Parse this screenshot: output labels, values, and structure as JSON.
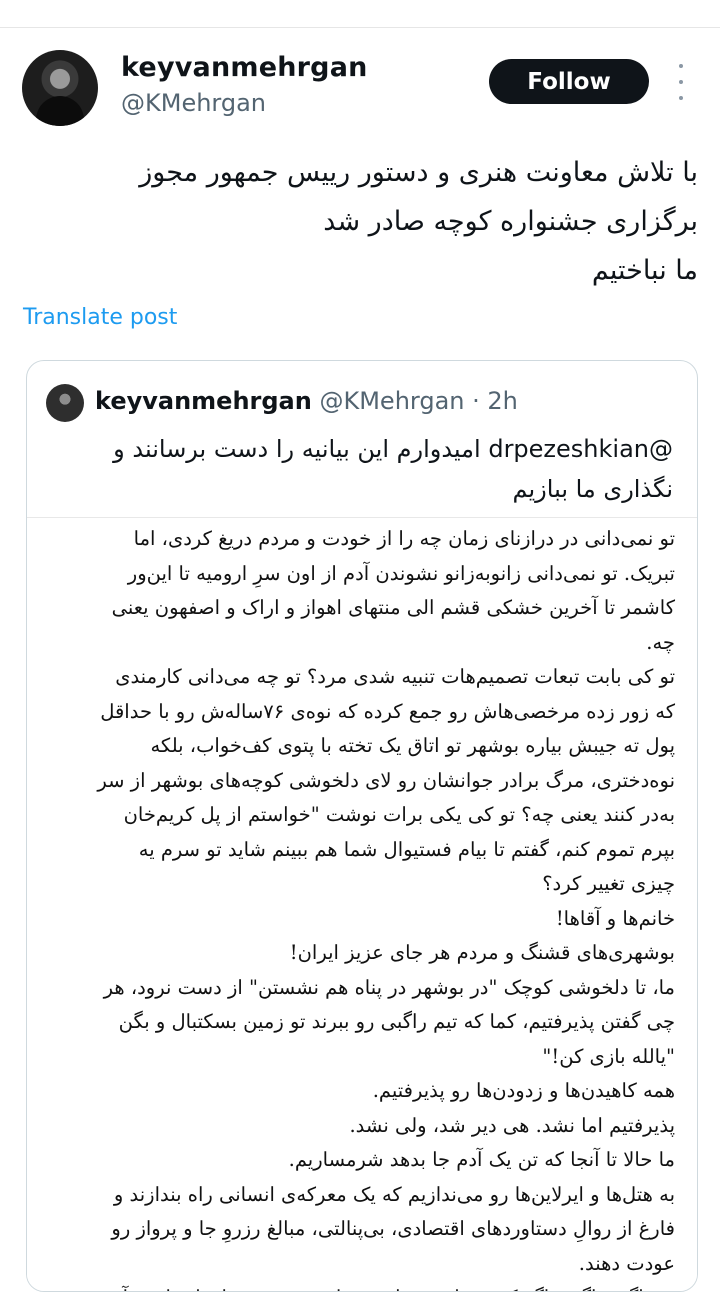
{
  "header": {
    "display_name": "keyvanmehrgan",
    "handle": "@KMehrgan",
    "follow_label": "Follow"
  },
  "tweet": {
    "lines": [
      "با تلاش معاونت هنری و دستور رییس جمهور مجوز",
      "برگزاری جشنواره کوچه صادر شد",
      "ما نباختیم"
    ],
    "translate_label": "Translate post"
  },
  "quoted": {
    "display_name": "keyvanmehrgan",
    "handle_time": "@KMehrgan · 2h",
    "text_lines": [
      "@drpezeshkian امیدوارم این بیانیه را دست برسانند و",
      "نگذاری ما ببازیم"
    ],
    "image_lines": [
      "تو نمی‌دانی در درازنای زمان چه را از خودت و مردم دریغ کردی، اما",
      "تبریک. تو نمی‌دانی زانوبه‌زانو نشوندن آدم از اون سرِ ارومیه تا این‌ور",
      "کاشمر تا آخرین خشکی قشم الی منتهای اهواز و اراک و اصفهون یعنی",
      "چه.",
      "تو کی بابت تبعات تصمیم‌هات تنبیه شدی مرد؟ تو چه می‌دانی کارمندی",
      "که زور زده مرخصی‌هاش رو جمع کرده که نوه‌ی ۷۶ساله‌ش رو با حداقل",
      "پول ته جیبش بیاره بوشهر تو اتاق یک تخته با پتوی کف‌خواب، بلکه",
      "نوه‌دختری، مرگ برادر جوانشان رو لای دلخوشی کوچه‌های بوشهر از سر",
      "به‌در کنند یعنی چه؟ تو کی یکی برات نوشت \"خواستم از پل کریم‌خان",
      "بپرم تموم کنم، گفتم تا بیام فستیوال شما هم ببینم شاید تو سرم یه",
      "چیزی تغییر کرد؟",
      "خانم‌ها و آقاها!",
      "بوشهری‌های قشنگ و مردم هر جای عزیز ایران!",
      "ما، تا دلخوشی کوچک \"در بوشهر در پناه هم نشستن\" از دست نرود، هر",
      "چی گفتن پذیرفتیم، کما که تیم راگبی رو ببرند تو زمین بسکتبال و بگن",
      "\"یالله بازی کن!\"",
      "همه کاهیدن‌ها و زدودن‌ها رو پذیرفتیم.",
      "پذیرفتیم اما نشد. هی دیر شد، ولی نشد.",
      "ما حالا تا آنجا که تن یک آدم جا بدهد شرمساریم.",
      "به هتل‌ها و ایرلاین‌ها رو می‌ندازیم که یک معرکه‌ی انسانی راه بندازند و",
      "فارغ از روالِ دستاوردهای اقتصادی، بی‌پنالتی، مبالغ رزروِ جا و پرواز رو",
      "عودت دهند.",
      "بعد اگر و اگر و اگر کسی دلش خواست علی‌رغم همه‌ی اینها، بیاید و آن"
    ]
  }
}
